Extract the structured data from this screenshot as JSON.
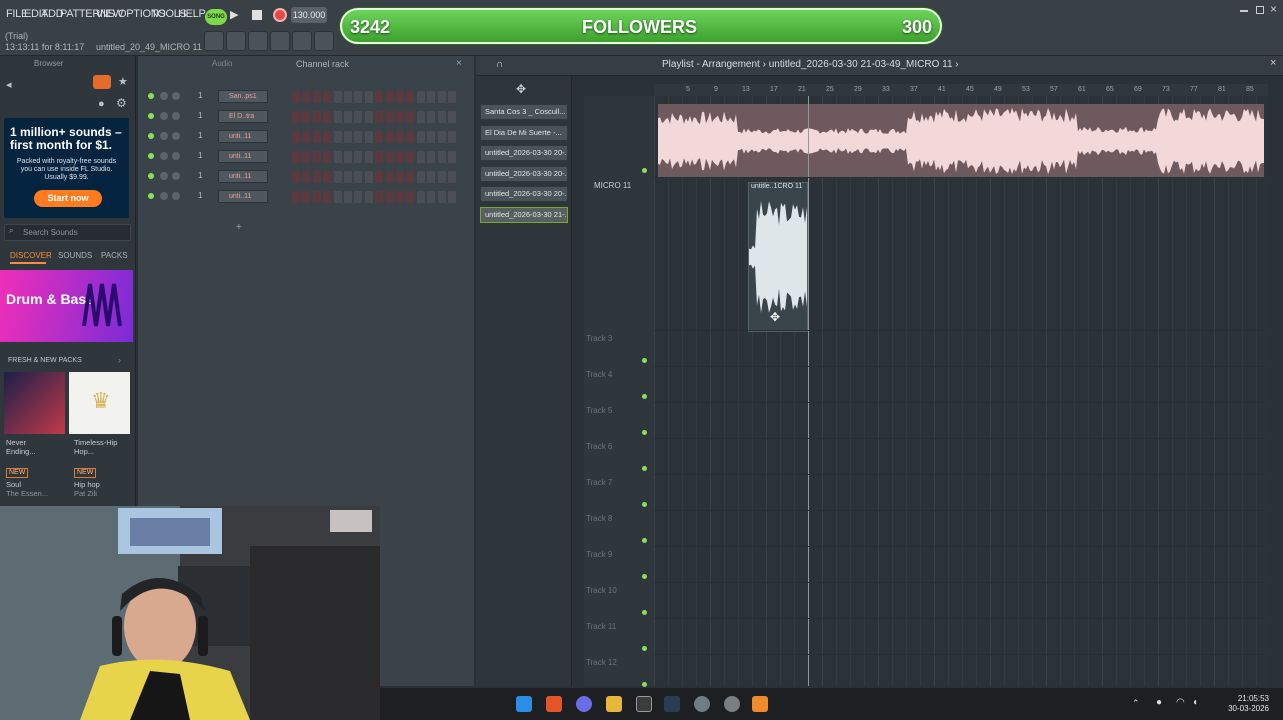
{
  "menu": [
    "FILE",
    "EDIT",
    "ADD",
    "PATTERNS",
    "VIEW",
    "OPTIONS",
    "TOOLS",
    "HELP"
  ],
  "song_mode": "SONG",
  "tempo": "130.000",
  "hint": {
    "line1": "(Trial)",
    "line2": "13:13:11 for 8:11:17",
    "project": "untitled_20_49_MICRO 11"
  },
  "followers": {
    "left": "3242",
    "label": "FOLLOWERS",
    "right": "300"
  },
  "browser": {
    "title": "Browser",
    "ad_title": "1 million+ sounds – first month for $1.",
    "ad_body": "Packed with royalty-free sounds you can use inside FL Studio. Usually $9.99.",
    "ad_cta": "Start now",
    "search_placeholder": "Search Sounds",
    "tabs": [
      "DISCOVER",
      "SOUNDS",
      "PACKS"
    ],
    "feature": "Drum & Bass",
    "section": "FRESH & NEW PACKS",
    "packs": [
      {
        "name": "Never Ending...",
        "badge": "NEW",
        "genre": "Soul",
        "author": "The Essen..."
      },
      {
        "name": "Timeless-Hip Hop...",
        "badge": "NEW",
        "genre": "Hip hop",
        "author": "Pat Zili"
      }
    ]
  },
  "channel_rack": {
    "title": "Channel rack",
    "filter": "Audio",
    "channels": [
      {
        "label": "San..ps1",
        "num": "1"
      },
      {
        "label": "El D..tra",
        "num": "1"
      },
      {
        "label": "unti..11",
        "num": "1"
      },
      {
        "label": "unti..11",
        "num": "1"
      },
      {
        "label": "unti..11",
        "num": "1"
      },
      {
        "label": "unti..11",
        "num": "1"
      }
    ]
  },
  "patterns": [
    "Santa Cos 3 _ Coscull...",
    "El Dia De Mi Suerte -...",
    "untitled_2026-03-30 20-...",
    "untitled_2026-03-30 20-...",
    "untitled_2026-03-30 20-...",
    "untitled_2026-03-30 21-..."
  ],
  "playlist": {
    "title": "Playlist - Arrangement › untitled_2026-03-30 21-03-49_MICRO 11 ›",
    "ruler": [
      "5",
      "9",
      "13",
      "17",
      "21",
      "25",
      "29",
      "33",
      "37",
      "41",
      "45",
      "49",
      "53",
      "57",
      "61",
      "65",
      "69",
      "73",
      "77",
      "81",
      "85"
    ],
    "tracks": [
      "MICRO 11",
      "Track 3",
      "Track 4",
      "Track 5",
      "Track 6",
      "Track 7",
      "Track 8",
      "Track 9",
      "Track 10",
      "Track 11",
      "Track 12"
    ],
    "clip_label": "untitle..1CRO 11"
  },
  "clock": {
    "time": "21:05:53",
    "date": "30-03-2026"
  }
}
